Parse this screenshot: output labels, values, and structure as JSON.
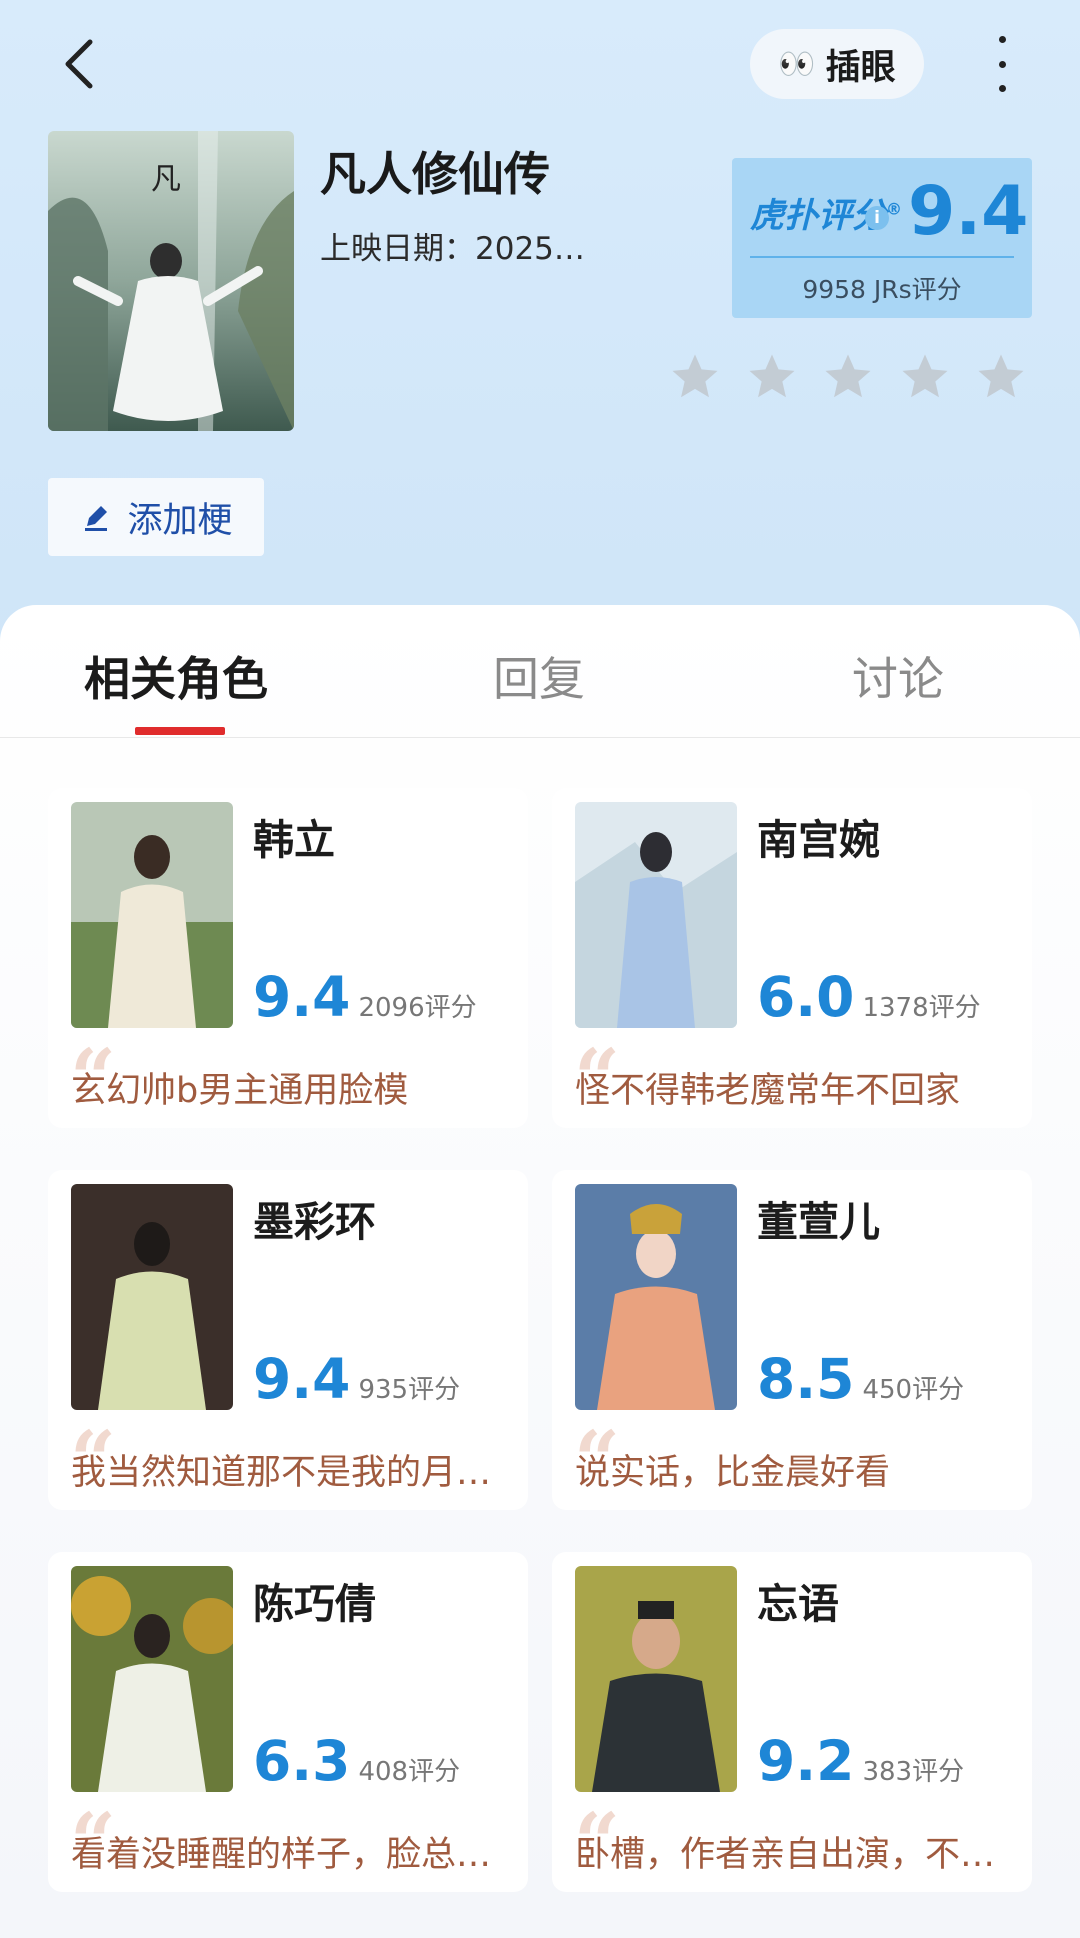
{
  "header": {
    "peek_button": {
      "emoji": "👀",
      "label": "插眼"
    }
  },
  "show": {
    "title": "凡人修仙传",
    "date": "上映日期：2025…",
    "score": {
      "brand": "虎扑评分",
      "brand_mark": "®",
      "info": "i",
      "value": "9.4",
      "count": "9958 JRs评分"
    },
    "stars_total": 5,
    "stars_filled": 0,
    "add_tag_label": "添加梗"
  },
  "tabs": [
    {
      "label": "相关角色",
      "active": true
    },
    {
      "label": "回复",
      "active": false
    },
    {
      "label": "讨论",
      "active": false
    }
  ],
  "characters": [
    {
      "name": "韩立",
      "score": "9.4",
      "count": "2096评分",
      "quote": "玄幻帅b男主通用脸模"
    },
    {
      "name": "南宫婉",
      "score": "6.0",
      "count": "1378评分",
      "quote": "怪不得韩老魔常年不回家"
    },
    {
      "name": "墨彩环",
      "score": "9.4",
      "count": "935评分",
      "quote": "我当然知道那不是我的月…"
    },
    {
      "name": "董萱儿",
      "score": "8.5",
      "count": "450评分",
      "quote": "说实话，比金晨好看"
    },
    {
      "name": "陈巧倩",
      "score": "6.3",
      "count": "408评分",
      "quote": "看着没睡醒的样子，脸总…"
    },
    {
      "name": "忘语",
      "score": "9.2",
      "count": "383评分",
      "quote": "卧槽，作者亲自出演，不…"
    }
  ],
  "colors": {
    "header_bg": "#d8ebfb",
    "accent_blue": "#1e86d6",
    "tab_indicator": "#e02c2c",
    "quote_text": "#a05b3f"
  }
}
